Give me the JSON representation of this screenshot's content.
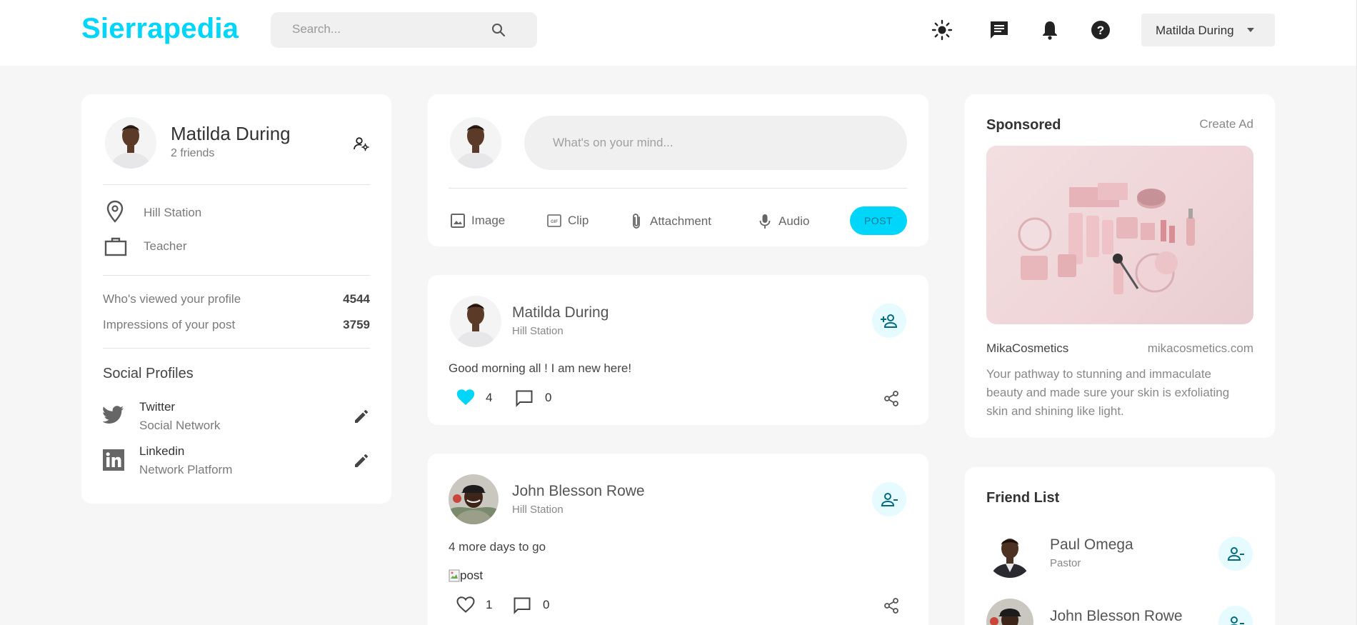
{
  "app": {
    "logo": "Sierrapedia"
  },
  "navbar": {
    "search_placeholder": "Search...",
    "user_name": "Matilda During"
  },
  "profile": {
    "name": "Matilda During",
    "friends": "2 friends",
    "location": "Hill Station",
    "occupation": "Teacher",
    "stats": [
      {
        "label": "Who's viewed your profile",
        "value": "4544"
      },
      {
        "label": "Impressions of your post",
        "value": "3759"
      }
    ],
    "social_title": "Social Profiles",
    "socials": [
      {
        "name": "Twitter",
        "type": "Social Network"
      },
      {
        "name": "Linkedin",
        "type": "Network Platform"
      }
    ]
  },
  "composer": {
    "placeholder": "What's on your mind...",
    "actions": [
      "Image",
      "Clip",
      "Attachment",
      "Audio"
    ],
    "post_label": "POST"
  },
  "posts": [
    {
      "author": "Matilda During",
      "location": "Hill Station",
      "text": "Good morning all ! I am new here!",
      "likes": "4",
      "comments": "0",
      "liked": true
    },
    {
      "author": "John Blesson Rowe",
      "location": "Hill Station",
      "text": "4 more days to go",
      "image_alt": "post",
      "likes": "1",
      "comments": "0",
      "liked": false
    }
  ],
  "sponsored": {
    "title": "Sponsored",
    "create_ad": "Create Ad",
    "brand": "MikaCosmetics",
    "url": "mikacosmetics.com",
    "description_lines": [
      "Your pathway to stunning and immaculate",
      "beauty and made sure your skin is exfoliating",
      "skin and shining like light."
    ]
  },
  "friend_list": {
    "title": "Friend List",
    "friends": [
      {
        "name": "Paul Omega",
        "role": "Pastor"
      },
      {
        "name": "John Blesson Rowe",
        "role": ""
      }
    ]
  },
  "colors": {
    "accent": "#00d5fa",
    "accent_light": "#e6fbff",
    "accent_dark": "#006b7f",
    "background": "#f6f6f6"
  },
  "icons": [
    "search-icon",
    "sun-icon",
    "chat-icon",
    "bell-icon",
    "help-icon",
    "location-pin-icon",
    "briefcase-icon",
    "manage-accounts-icon",
    "twitter-icon",
    "linkedin-icon",
    "edit-icon",
    "image-icon",
    "gif-icon",
    "attachment-icon",
    "mic-icon",
    "heart-icon",
    "comment-icon",
    "share-icon",
    "add-friend-icon",
    "remove-friend-icon"
  ]
}
